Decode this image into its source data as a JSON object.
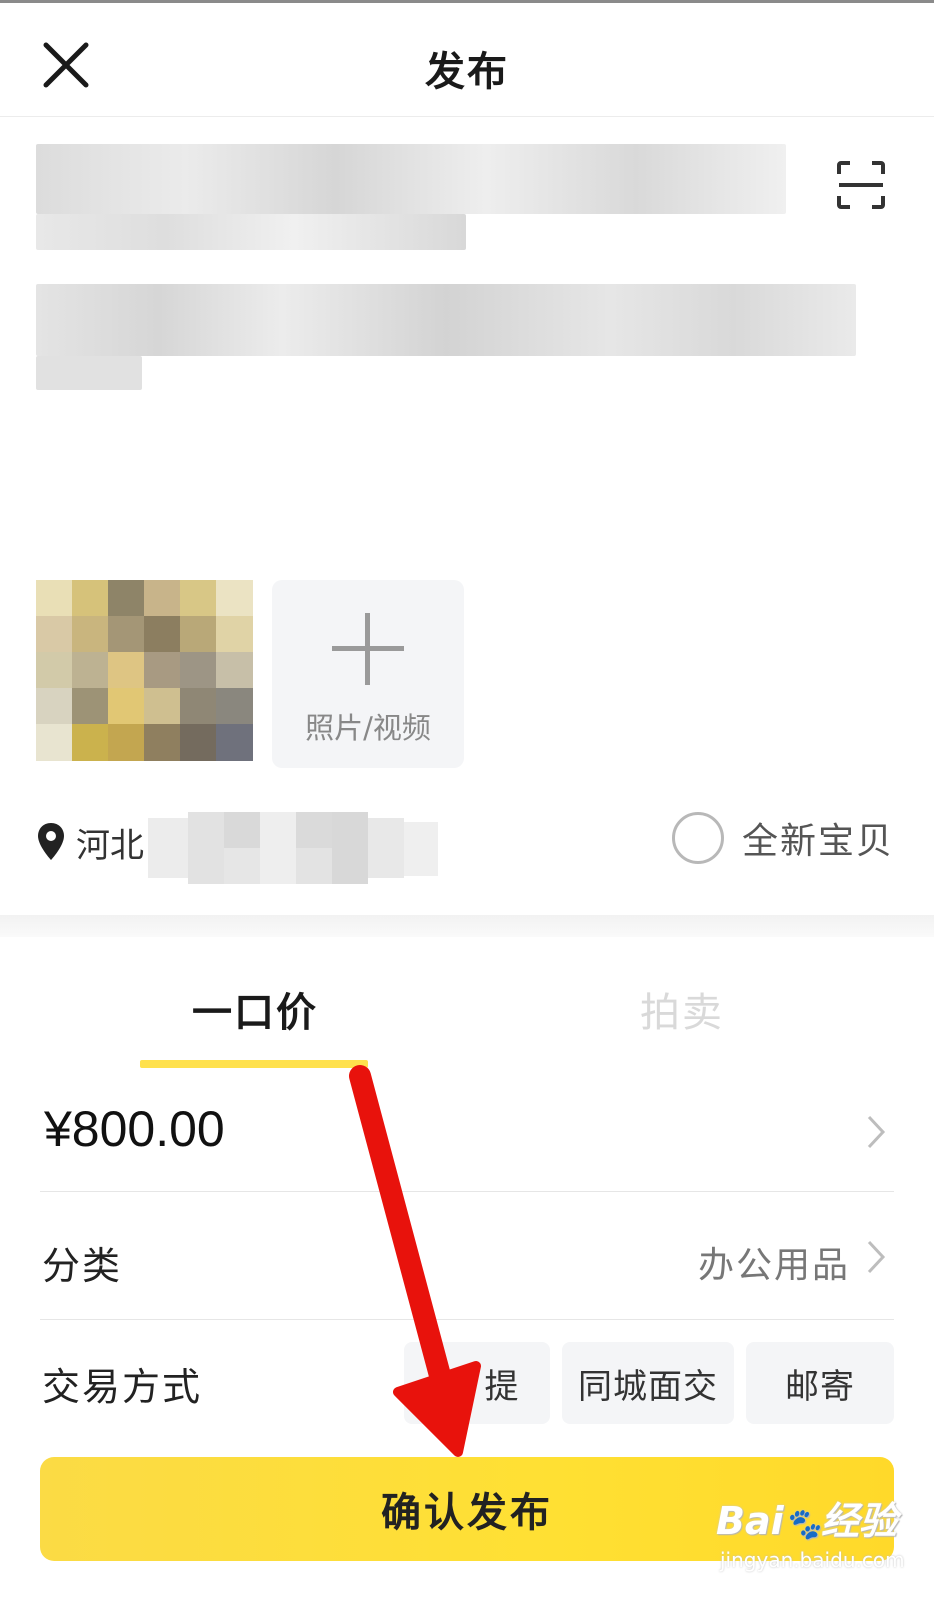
{
  "header": {
    "title": "发布"
  },
  "media": {
    "add_label": "照片/视频"
  },
  "location": {
    "text": "河北"
  },
  "condition": {
    "new_item_label": "全新宝贝"
  },
  "tabs": [
    {
      "label": "一口价",
      "active": true
    },
    {
      "label": "拍卖",
      "active": false
    }
  ],
  "price": {
    "value": "¥800.00"
  },
  "category": {
    "label": "分类",
    "value": "办公用品"
  },
  "trade": {
    "label": "交易方式",
    "options": [
      "自提",
      "同城面交",
      "邮寄"
    ],
    "visible_partial": "提"
  },
  "confirm": {
    "label": "确认发布"
  },
  "watermark": {
    "logo": "Bai du 经验",
    "url": "jingyan.baidu.com"
  },
  "colors": {
    "accent_yellow": "#ffe14d",
    "arrow_red": "#e8120c"
  },
  "icons": [
    "close-icon",
    "scan-icon",
    "plus-icon",
    "location-pin-icon",
    "radio-icon",
    "chevron-right-icon"
  ]
}
